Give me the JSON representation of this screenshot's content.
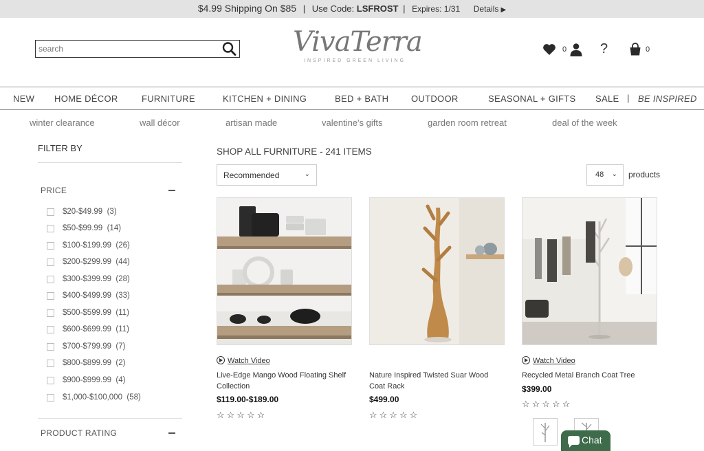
{
  "promo": {
    "shipping": "$4.99 Shipping On $85",
    "sep1": "|",
    "use_code_label": "Use Code:",
    "code": "LSFROST",
    "sep2": "|",
    "expires": "Expires: 1/31",
    "details": "Details",
    "details_arrow": "▶"
  },
  "header": {
    "search_placeholder": "search",
    "logo_name": "VivaTerra",
    "logo_tagline": "INSPIRED GREEN LIVING",
    "wishlist_count": "0",
    "help_label": "?",
    "cart_count": "0"
  },
  "nav": {
    "items": [
      "NEW",
      "HOME DÉCOR",
      "FURNITURE",
      "KITCHEN + DINING",
      "BED + BATH",
      "OUTDOOR",
      "SEASONAL + GIFTS",
      "SALE"
    ],
    "separator": "|",
    "be_inspired": "BE INSPIRED"
  },
  "subnav": {
    "items": [
      "winter clearance",
      "wall décor",
      "artisan made",
      "valentine's gifts",
      "garden room retreat",
      "deal of the week"
    ]
  },
  "filters": {
    "title": "FILTER BY",
    "price_heading": "PRICE",
    "price_options": [
      {
        "label": "$20-$49.99",
        "count": "(3)"
      },
      {
        "label": "$50-$99.99",
        "count": "(14)"
      },
      {
        "label": "$100-$199.99",
        "count": "(26)"
      },
      {
        "label": "$200-$299.99",
        "count": "(44)"
      },
      {
        "label": "$300-$399.99",
        "count": "(28)"
      },
      {
        "label": "$400-$499.99",
        "count": "(33)"
      },
      {
        "label": "$500-$599.99",
        "count": "(11)"
      },
      {
        "label": "$600-$699.99",
        "count": "(11)"
      },
      {
        "label": "$700-$799.99",
        "count": "(7)"
      },
      {
        "label": "$800-$899.99",
        "count": "(2)"
      },
      {
        "label": "$900-$999.99",
        "count": "(4)"
      },
      {
        "label": "$1,000-$100,000",
        "count": "(58)"
      }
    ],
    "rating_heading": "PRODUCT RATING"
  },
  "listing": {
    "title": "SHOP ALL FURNITURE - 241 ITEMS",
    "sort_value": "Recommended",
    "per_page_value": "48",
    "per_page_label": "products"
  },
  "products": [
    {
      "watch_video": "Watch Video",
      "name": "Live-Edge Mango Wood Floating Shelf Collection",
      "price": "$119.00-$189.00",
      "stars": "☆☆☆☆☆",
      "rating": 0
    },
    {
      "name": "Nature Inspired Twisted Suar Wood Coat Rack",
      "price": "$499.00",
      "stars": "☆☆☆☆☆",
      "rating": 0
    },
    {
      "watch_video": "Watch Video",
      "name": "Recycled Metal Branch Coat Tree",
      "price": "$399.00",
      "stars": "☆☆☆☆☆",
      "rating": 0
    }
  ],
  "chat": {
    "label": "Chat"
  },
  "colors": {
    "promo_bg": "#e3e3e3",
    "chat_bg": "#3e6b4a"
  }
}
